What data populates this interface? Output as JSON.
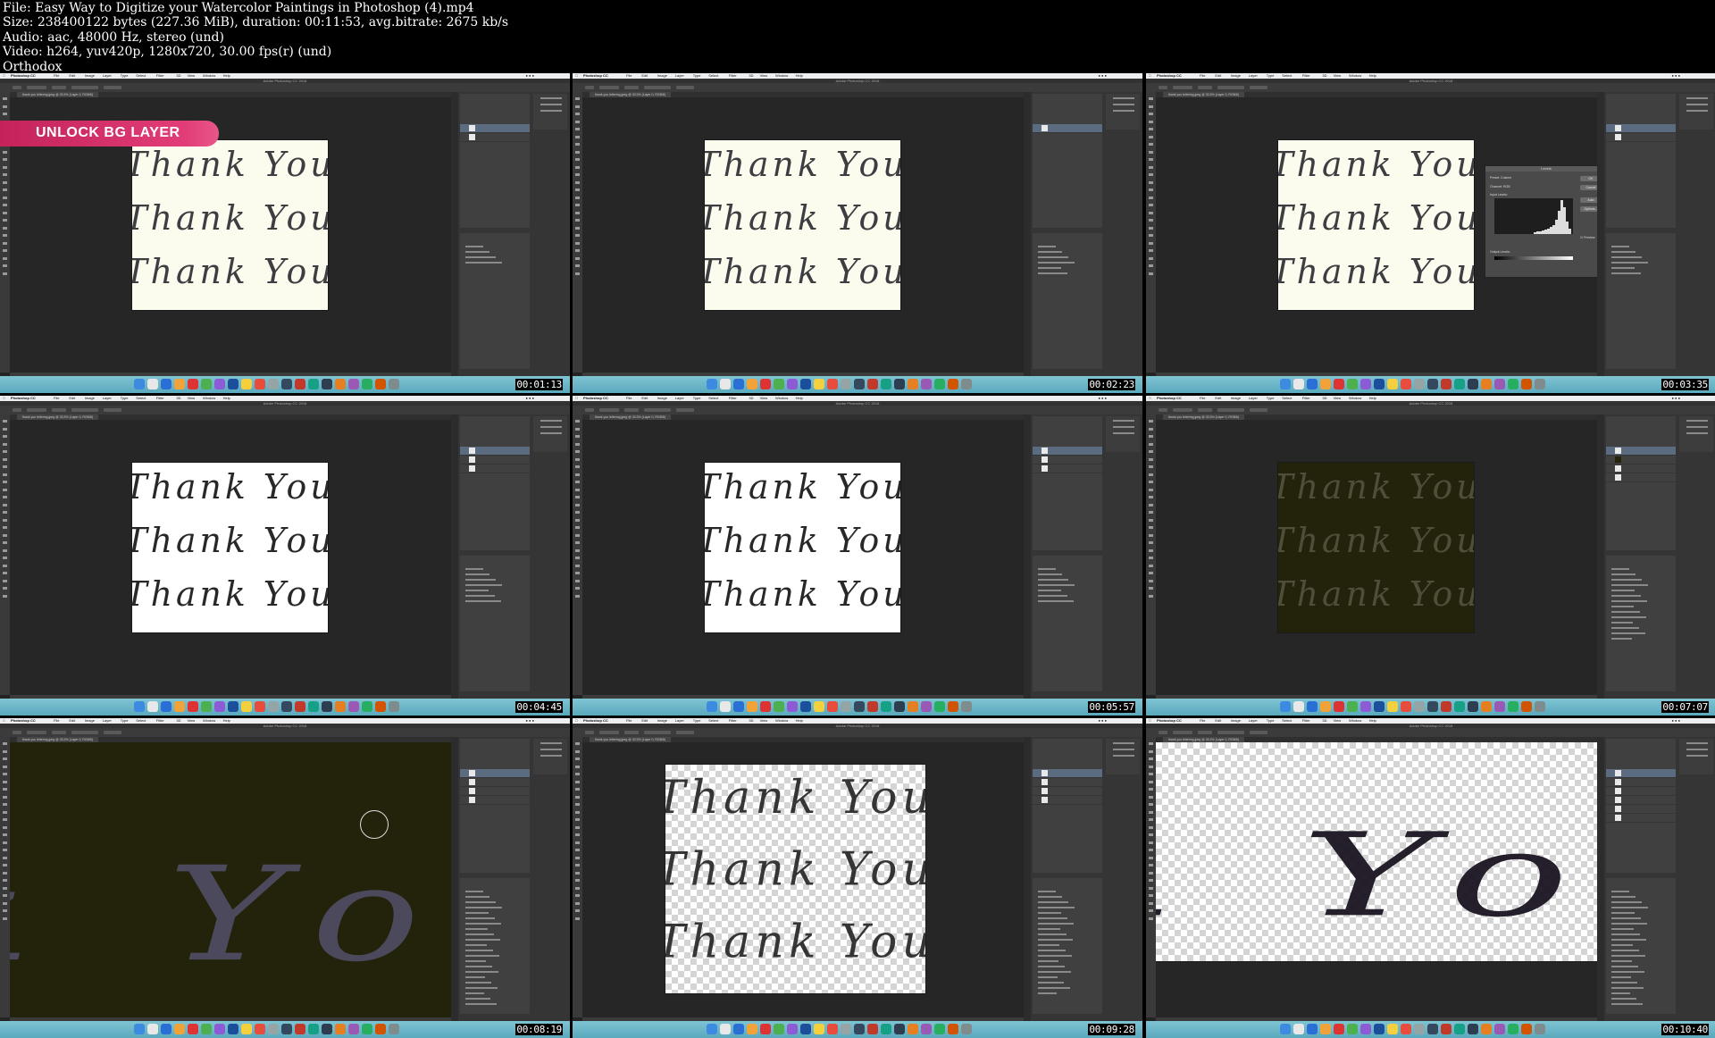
{
  "header": {
    "file_line": "File: Easy Way to Digitize your Watercolor Paintings in Photoshop (4).mp4",
    "size_line": "Size: 238400122 bytes (227.36 MiB), duration: 00:11:53, avg.bitrate: 2675 kb/s",
    "audio_line": "Audio: aac, 48000 Hz, stereo (und)",
    "video_line": "Video: h264, yuv420p, 1280x720, 30.00 fps(r) (und)",
    "author_line": "Orthodox"
  },
  "app": {
    "name": "Photoshop CC",
    "window_title": "Adobe Photoshop CC 2018",
    "menus": [
      "File",
      "Edit",
      "Image",
      "Layer",
      "Type",
      "Select",
      "Filter",
      "3D",
      "View",
      "Window",
      "Help"
    ]
  },
  "banner": {
    "label": "UNLOCK BG LAYER"
  },
  "frames": [
    {
      "timestamp": "00:01:13",
      "artwork": "Thank You"
    },
    {
      "timestamp": "00:02:23",
      "artwork": "Thank You"
    },
    {
      "timestamp": "00:03:35",
      "artwork": "Thank You",
      "dialog": {
        "title": "Levels",
        "preset_label": "Preset:",
        "preset_value": "Custom",
        "channel_label": "Channel:",
        "channel_value": "RGB",
        "input_label": "Input Levels:",
        "output_label": "Output Levels:",
        "ok": "OK",
        "cancel": "Cancel",
        "auto": "Auto",
        "options": "Options...",
        "preview": "Preview"
      }
    },
    {
      "timestamp": "00:04:45",
      "artwork": "Thank You"
    },
    {
      "timestamp": "00:05:57",
      "artwork": "Thank You"
    },
    {
      "timestamp": "00:07:07",
      "artwork": "Thank You"
    },
    {
      "timestamp": "00:08:19",
      "artwork": "nk You"
    },
    {
      "timestamp": "00:09:28",
      "artwork": "Thank You"
    },
    {
      "timestamp": "00:10:40",
      "artwork": "nk You"
    }
  ],
  "colors": {
    "ui_dark": "#242424",
    "panel": "#353535",
    "paper_cream": "#fbfbee",
    "paper_white": "#ffffff",
    "olive_overlay": "#23230c",
    "dock": "#6cb8cb",
    "banner": "#d42d68",
    "ink": "#2a2a30"
  },
  "icons": [
    "apple-icon",
    "finder-icon",
    "photoshop-icon",
    "brush-icon",
    "move-icon",
    "lasso-icon",
    "crop-icon",
    "eyedropper-icon",
    "eraser-icon",
    "type-icon",
    "zoom-icon"
  ]
}
